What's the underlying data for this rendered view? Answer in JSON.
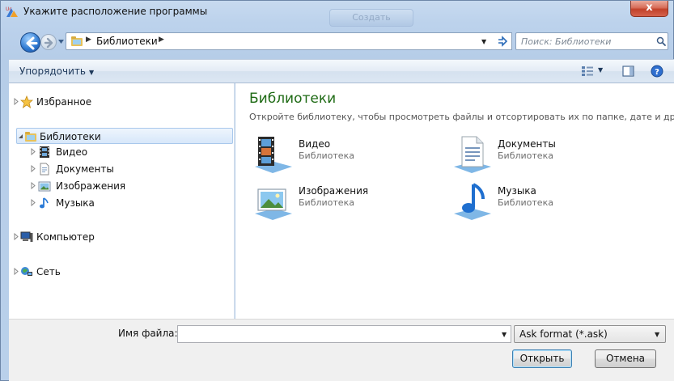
{
  "window": {
    "title": "Укажите расположение программы",
    "background_button_label": "Создать",
    "close_label": "x"
  },
  "address": {
    "crumb": "Библиотеки",
    "separator": "▶",
    "search_placeholder": "Поиск: Библиотеки"
  },
  "toolbar": {
    "organize_label": "Упорядочить",
    "organize_arrow": "▼",
    "view_drop": "▼"
  },
  "nav": {
    "favorites": "Избранное",
    "libraries": "Библиотеки",
    "video": "Видео",
    "documents": "Документы",
    "images": "Изображения",
    "music": "Музыка",
    "computer": "Компьютер",
    "network": "Сеть"
  },
  "content": {
    "title": "Библиотеки",
    "subtitle": "Откройте библиотеку, чтобы просмотреть файлы и отсортировать их по папке, дате и др...",
    "tiles": [
      {
        "name": "Видео",
        "kind": "Библиотека"
      },
      {
        "name": "Документы",
        "kind": "Библиотека"
      },
      {
        "name": "Изображения",
        "kind": "Библиотека"
      },
      {
        "name": "Музыка",
        "kind": "Библиотека"
      }
    ]
  },
  "footer": {
    "filename_label": "Имя файла:",
    "filename_value": "",
    "filter_value": "Ask format (*.ask)",
    "open_label": "Открыть",
    "cancel_label": "Отмена"
  },
  "colors": {
    "library_title": "#1e6a14",
    "close_button": "#c2412a",
    "selection": "#d7e7fa"
  }
}
